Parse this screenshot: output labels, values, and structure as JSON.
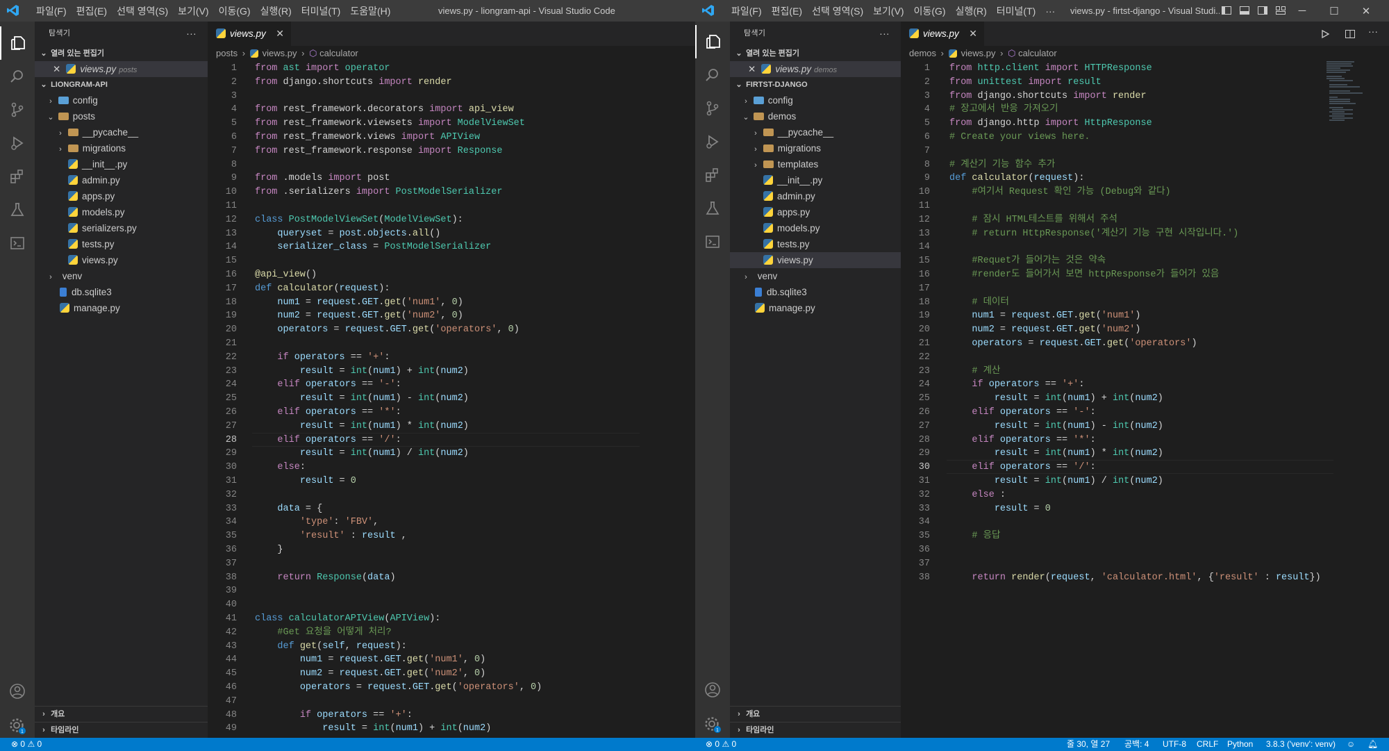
{
  "left": {
    "menu": [
      "파일(F)",
      "편집(E)",
      "선택 영역(S)",
      "보기(V)",
      "이동(G)",
      "실행(R)",
      "터미널(T)",
      "도움말(H)"
    ],
    "window_title": "views.py - liongram-api - Visual Studio Code",
    "sidebar": {
      "title": "탐색기",
      "more": "···",
      "open_editors": "열려 있는 편집기",
      "open_file": "views.py",
      "open_file_desc": "posts",
      "project": "LIONGRAM-API",
      "tree": {
        "config": "config",
        "posts": "posts",
        "pycache": "__pycache__",
        "migrations": "migrations",
        "init": "__init__.py",
        "admin": "admin.py",
        "apps": "apps.py",
        "models": "models.py",
        "serializers": "serializers.py",
        "tests": "tests.py",
        "views": "views.py",
        "venv": "venv",
        "db": "db.sqlite3",
        "manage": "manage.py"
      },
      "outline": "개요",
      "timeline": "타임라인"
    },
    "tab": "views.py",
    "breadcrumb": {
      "folder": "posts",
      "file": "views.py",
      "symbol": "calculator"
    },
    "status": {
      "errors": "0",
      "warnings": "0"
    }
  },
  "right": {
    "menu": [
      "파일(F)",
      "편집(E)",
      "선택 영역(S)",
      "보기(V)",
      "이동(G)",
      "실행(R)",
      "터미널(T)",
      "···"
    ],
    "window_title": "views.py - firtst-django - Visual Studi...",
    "sidebar": {
      "title": "탐색기",
      "more": "···",
      "open_editors": "열려 있는 편집기",
      "open_file": "views.py",
      "open_file_desc": "demos",
      "project": "FIRTST-DJANGO",
      "tree": {
        "config": "config",
        "demos": "demos",
        "pycache": "__pycache__",
        "migrations": "migrations",
        "templates": "templates",
        "init": "__init__.py",
        "admin": "admin.py",
        "apps": "apps.py",
        "models": "models.py",
        "tests": "tests.py",
        "views": "views.py",
        "venv": "venv",
        "db": "db.sqlite3",
        "manage": "manage.py"
      },
      "outline": "개요",
      "timeline": "타임라인"
    },
    "tab": "views.py",
    "breadcrumb": {
      "folder": "demos",
      "file": "views.py",
      "symbol": "calculator"
    },
    "status": {
      "errors": "0",
      "warnings": "0",
      "position": "줄 30, 열 27",
      "spaces": "공백: 4",
      "encoding": "UTF-8",
      "eol": "CRLF",
      "language": "Python",
      "interpreter": "3.8.3 ('venv': venv)"
    }
  },
  "colors": {
    "statusbar": "#007acc",
    "titlebar": "#3c3c3c",
    "activitybar": "#333333",
    "sidebar": "#252526",
    "editor": "#1e1e1e"
  }
}
